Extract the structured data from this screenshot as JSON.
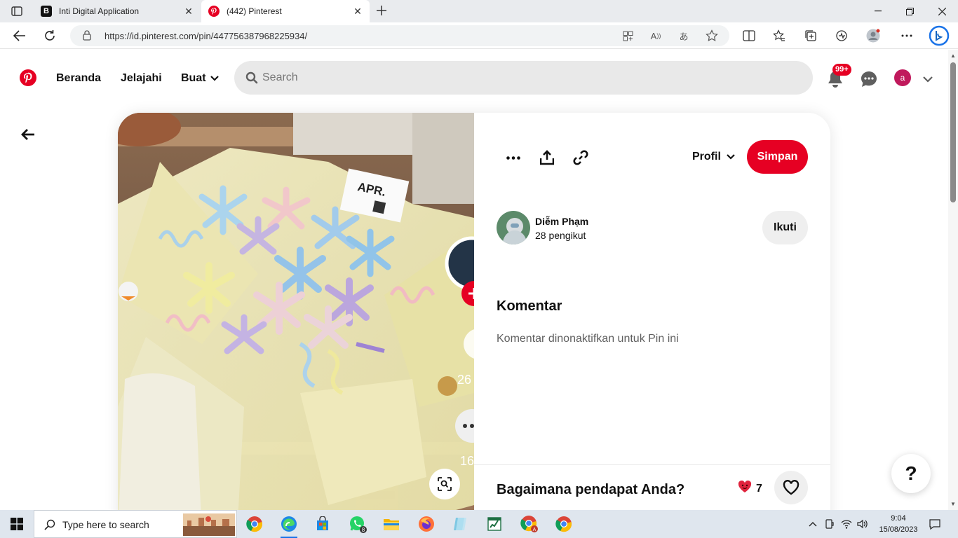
{
  "browser": {
    "tabs": [
      {
        "title": "Inti Digital Application",
        "favicon_letter": "B"
      },
      {
        "title": "(442) Pinterest",
        "active": true
      }
    ],
    "url": "https://id.pinterest.com/pin/447756387968225934/"
  },
  "header": {
    "nav": [
      "Beranda",
      "Jelajahi",
      "Buat"
    ],
    "search_placeholder": "Search",
    "notification_badge": "99+",
    "avatar_letter": "a"
  },
  "pin": {
    "actions": {
      "profile_select": "Profil",
      "save_label": "Simpan"
    },
    "creator": {
      "name": "Diễm Phạm",
      "followers": "28 pengikut",
      "follow_label": "Ikuti"
    },
    "comments": {
      "heading": "Komentar",
      "disabled_text": "Komentar dinonaktifkan untuk Pin ini"
    },
    "feedback": {
      "question": "Bagaimana pendapat Anda?",
      "reaction_count": "7"
    }
  },
  "photo_overlay_text": {
    "count_1": "26",
    "count_2": "16",
    "card_tag": "APR."
  },
  "help_label": "?",
  "taskbar": {
    "search_placeholder": "Type here to search",
    "whatsapp_badge": "8",
    "time": "9:04",
    "date": "15/08/2023"
  },
  "colors": {
    "brand_red": "#e60023",
    "avatar_bg": "#c0195c",
    "taskbar_bg": "#dfe6ee"
  }
}
